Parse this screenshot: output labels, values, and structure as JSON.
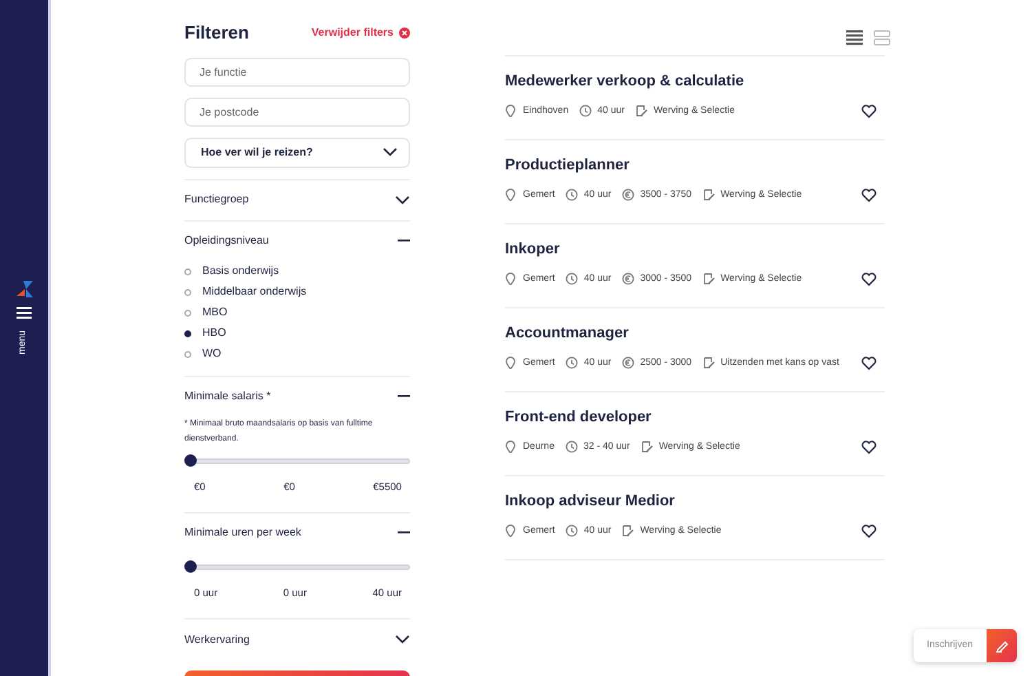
{
  "sidebar": {
    "menu_label": "menu"
  },
  "filters": {
    "title": "Filteren",
    "clear_label": "Verwijder filters",
    "fields": [
      {
        "placeholder": "Je functie"
      },
      {
        "placeholder": "Je postcode"
      }
    ],
    "distance_select": "Hoe ver wil je reizen?",
    "sections": [
      {
        "title": "Functiegroep",
        "expanded": false
      },
      {
        "kind": "radio",
        "title": "Opleidingsniveau",
        "expanded": true,
        "options": [
          {
            "label": "Basis onderwijs",
            "selected": false
          },
          {
            "label": "Middelbaar onderwijs",
            "selected": false
          },
          {
            "label": "MBO",
            "selected": false
          },
          {
            "label": "HBO",
            "selected": true
          },
          {
            "label": "WO",
            "selected": false
          }
        ]
      },
      {
        "kind": "slider",
        "title": "Minimale salaris *",
        "expanded": true,
        "note": "* Minimaal bruto maandsalaris op basis van fulltime dienstverband.",
        "level": 0,
        "labels": [
          "€0",
          "€0",
          "€5500"
        ]
      },
      {
        "kind": "slider",
        "title": "Minimale uren per week",
        "expanded": true,
        "level": 0,
        "labels": [
          "0 uur",
          "0 uur",
          "40 uur"
        ]
      },
      {
        "title": "Werkervaring",
        "expanded": false
      }
    ]
  },
  "view_toggle": [
    {
      "kind": "list",
      "selected": true
    },
    {
      "kind": "grid",
      "selected": false
    }
  ],
  "jobs": [
    {
      "title": "Medewerker verkoop & calculatie",
      "favorite": false,
      "meta": [
        {
          "kind": "location",
          "text": "Eindhoven"
        },
        {
          "kind": "hours",
          "text": "40 uur"
        },
        {
          "kind": "contract",
          "text": "Werving & Selectie"
        }
      ]
    },
    {
      "title": "Productieplanner",
      "favorite": false,
      "meta": [
        {
          "kind": "location",
          "text": "Gemert"
        },
        {
          "kind": "hours",
          "text": "40 uur"
        },
        {
          "kind": "salary",
          "text": "3500 - 3750"
        },
        {
          "kind": "contract",
          "text": "Werving & Selectie"
        }
      ]
    },
    {
      "title": "Inkoper",
      "favorite": false,
      "meta": [
        {
          "kind": "location",
          "text": "Gemert"
        },
        {
          "kind": "hours",
          "text": "40 uur"
        },
        {
          "kind": "salary",
          "text": "3000 - 3500"
        },
        {
          "kind": "contract",
          "text": "Werving & Selectie"
        }
      ]
    },
    {
      "title": "Accountmanager",
      "favorite": false,
      "meta": [
        {
          "kind": "location",
          "text": "Gemert"
        },
        {
          "kind": "hours",
          "text": "40 uur"
        },
        {
          "kind": "salary",
          "text": "2500 - 3000"
        },
        {
          "kind": "contract",
          "text": "Uitzenden met kans op vast"
        }
      ]
    },
    {
      "title": "Front-end developer",
      "favorite": false,
      "meta": [
        {
          "kind": "location",
          "text": "Deurne"
        },
        {
          "kind": "hours",
          "text": "32 - 40 uur"
        },
        {
          "kind": "contract",
          "text": "Werving & Selectie"
        }
      ]
    },
    {
      "title": "Inkoop adviseur Medior",
      "favorite": false,
      "meta": [
        {
          "kind": "location",
          "text": "Gemert"
        },
        {
          "kind": "hours",
          "text": "40 uur"
        },
        {
          "kind": "contract",
          "text": "Werving & Selectie"
        }
      ]
    }
  ],
  "subscribe_button": "Inschrijven"
}
